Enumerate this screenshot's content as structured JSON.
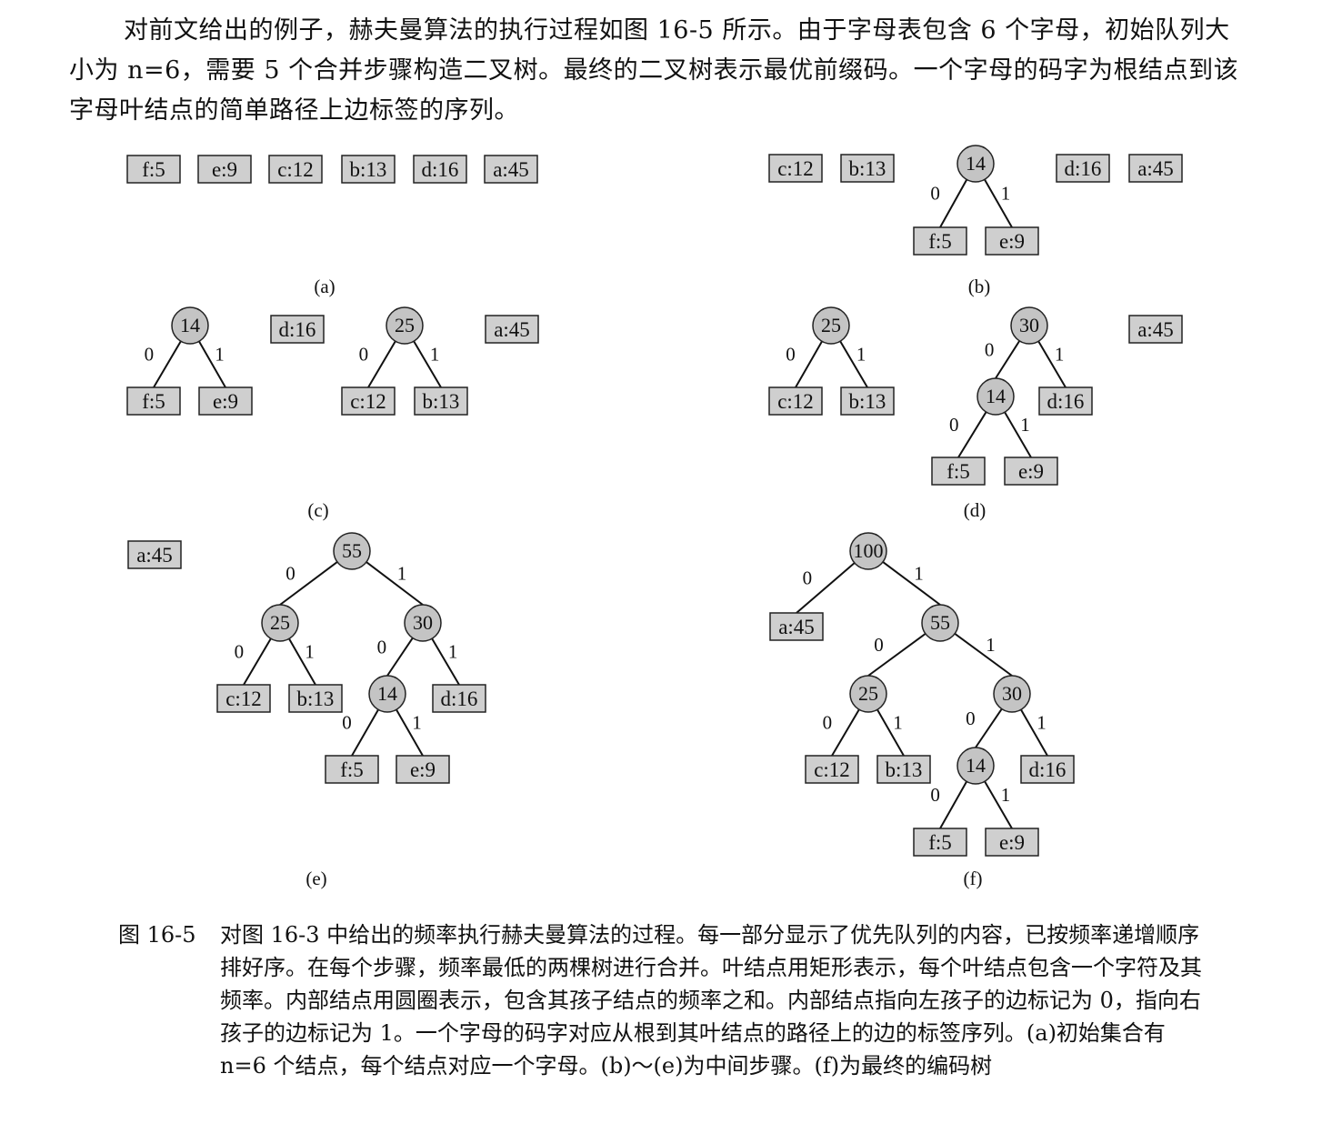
{
  "intro_text": "对前文给出的例子，赫夫曼算法的执行过程如图 16-5 所示。由于字母表包含 6 个字母，初始队列大小为 n=6，需要 5 个合并步骤构造二叉树。最终的二叉树表示最优前缀码。一个字母的码字为根结点到该字母叶结点的简单路径上边标签的序列。",
  "figure": {
    "panels": [
      {
        "label": "(a)",
        "forest": [
          {
            "leaf": "f:5"
          },
          {
            "leaf": "e:9"
          },
          {
            "leaf": "c:12"
          },
          {
            "leaf": "b:13"
          },
          {
            "leaf": "d:16"
          },
          {
            "leaf": "a:45"
          }
        ]
      },
      {
        "label": "(b)",
        "forest": [
          {
            "leaf": "c:12"
          },
          {
            "leaf": "b:13"
          },
          {
            "value": "14",
            "left": {
              "leaf": "f:5"
            },
            "right": {
              "leaf": "e:9"
            }
          },
          {
            "leaf": "d:16"
          },
          {
            "leaf": "a:45"
          }
        ]
      },
      {
        "label": "(c)",
        "forest": [
          {
            "value": "14",
            "left": {
              "leaf": "f:5"
            },
            "right": {
              "leaf": "e:9"
            }
          },
          {
            "leaf": "d:16"
          },
          {
            "value": "25",
            "left": {
              "leaf": "c:12"
            },
            "right": {
              "leaf": "b:13"
            }
          },
          {
            "leaf": "a:45"
          }
        ]
      },
      {
        "label": "(d)",
        "forest": [
          {
            "value": "25",
            "left": {
              "leaf": "c:12"
            },
            "right": {
              "leaf": "b:13"
            }
          },
          {
            "value": "30",
            "left": {
              "value": "14",
              "left": {
                "leaf": "f:5"
              },
              "right": {
                "leaf": "e:9"
              }
            },
            "right": {
              "leaf": "d:16"
            }
          },
          {
            "leaf": "a:45"
          }
        ]
      },
      {
        "label": "(e)",
        "forest": [
          {
            "leaf": "a:45"
          },
          {
            "value": "55",
            "left": {
              "value": "25",
              "left": {
                "leaf": "c:12"
              },
              "right": {
                "leaf": "b:13"
              }
            },
            "right": {
              "value": "30",
              "left": {
                "value": "14",
                "left": {
                  "leaf": "f:5"
                },
                "right": {
                  "leaf": "e:9"
                }
              },
              "right": {
                "leaf": "d:16"
              }
            }
          }
        ]
      },
      {
        "label": "(f)",
        "forest": [
          {
            "value": "100",
            "left": {
              "leaf": "a:45"
            },
            "right": {
              "value": "55",
              "left": {
                "value": "25",
                "left": {
                  "leaf": "c:12"
                },
                "right": {
                  "leaf": "b:13"
                }
              },
              "right": {
                "value": "30",
                "left": {
                  "value": "14",
                  "left": {
                    "leaf": "f:5"
                  },
                  "right": {
                    "leaf": "e:9"
                  }
                },
                "right": {
                  "leaf": "d:16"
                }
              }
            }
          }
        ]
      }
    ],
    "edge_labels": {
      "left": "0",
      "right": "1"
    }
  },
  "caption": {
    "label": "图 16-5",
    "text": "对图 16-3 中给出的频率执行赫夫曼算法的过程。每一部分显示了优先队列的内容，已按频率递增顺序排好序。在每个步骤，频率最低的两棵树进行合并。叶结点用矩形表示，每个叶结点包含一个字符及其频率。内部结点用圆圈表示，包含其孩子结点的频率之和。内部结点指向左孩子的边标记为 0，指向右孩子的边标记为 1。一个字母的码字对应从根到其叶结点的路径上的边的标签序列。(a)初始集合有 n=6 个结点，每个结点对应一个字母。(b)～(e)为中间步骤。(f)为最终的编码树"
  },
  "colors": {
    "node_fill": "#c4c4c4",
    "leaf_fill": "#cfcfcf",
    "ink": "#111111"
  }
}
